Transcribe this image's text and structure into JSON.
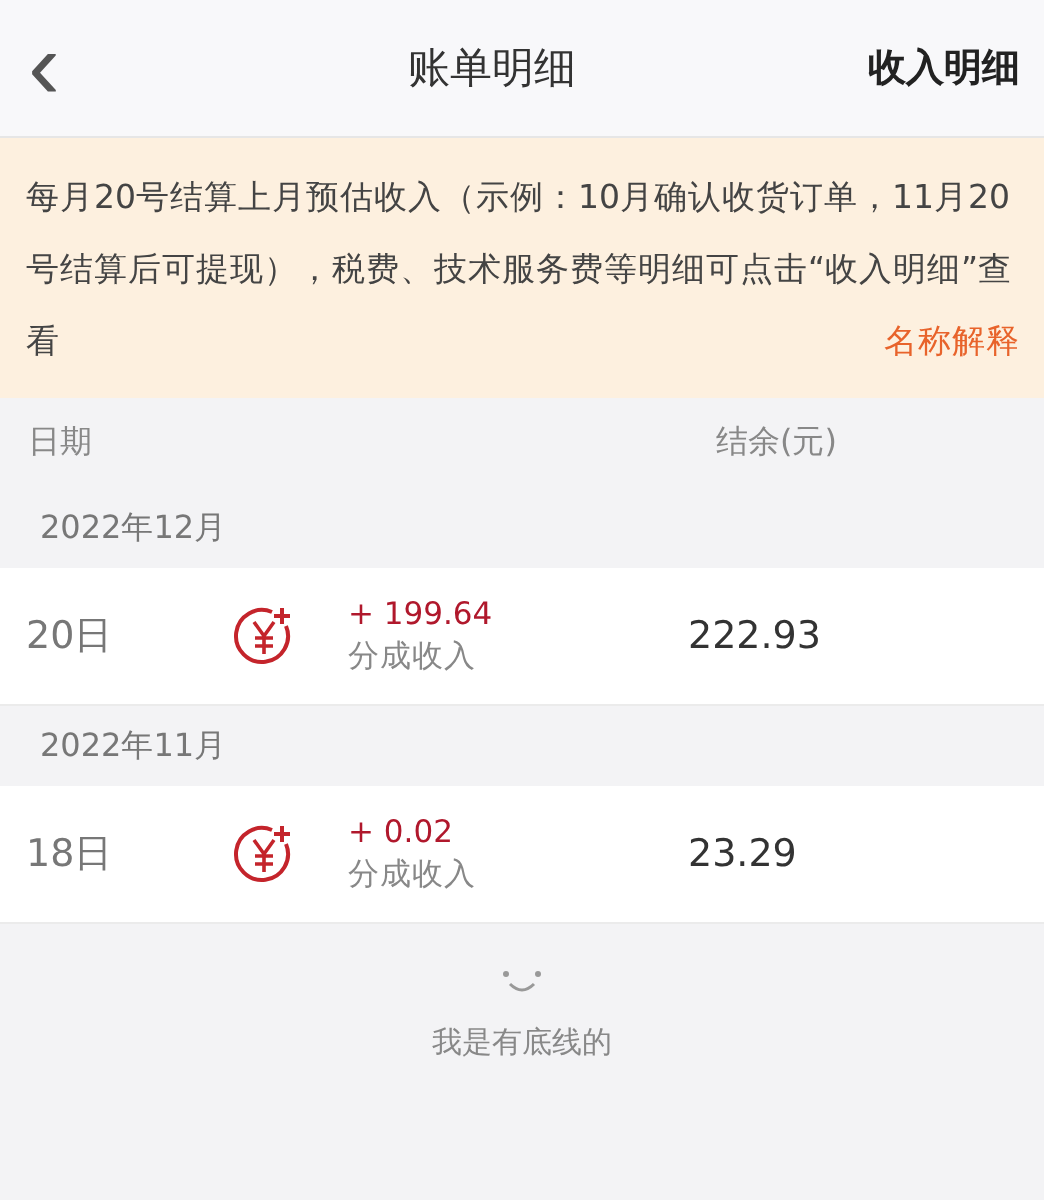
{
  "header": {
    "back_icon": "‹",
    "title": "账单明细",
    "action": "收入明细"
  },
  "notice": {
    "text": "每月20号结算上月预估收入（示例：10月确认收货订单，11月20号结算后可提现），税费、技术服务费等明细可点击“收入明细”查看",
    "link": "名称解释"
  },
  "columns": [
    "日期",
    "结余(元)"
  ],
  "groups": [
    {
      "month": "2022年12月",
      "rows": [
        {
          "day": "20日",
          "amount": "+ 199.64",
          "type": "分成收入",
          "balance": "222.93"
        }
      ]
    },
    {
      "month": "2022年11月",
      "rows": [
        {
          "day": "18日",
          "amount": "+ 0.02",
          "type": "分成收入",
          "balance": "23.29"
        }
      ]
    }
  ],
  "footer": {
    "text": "我是有底线的"
  }
}
